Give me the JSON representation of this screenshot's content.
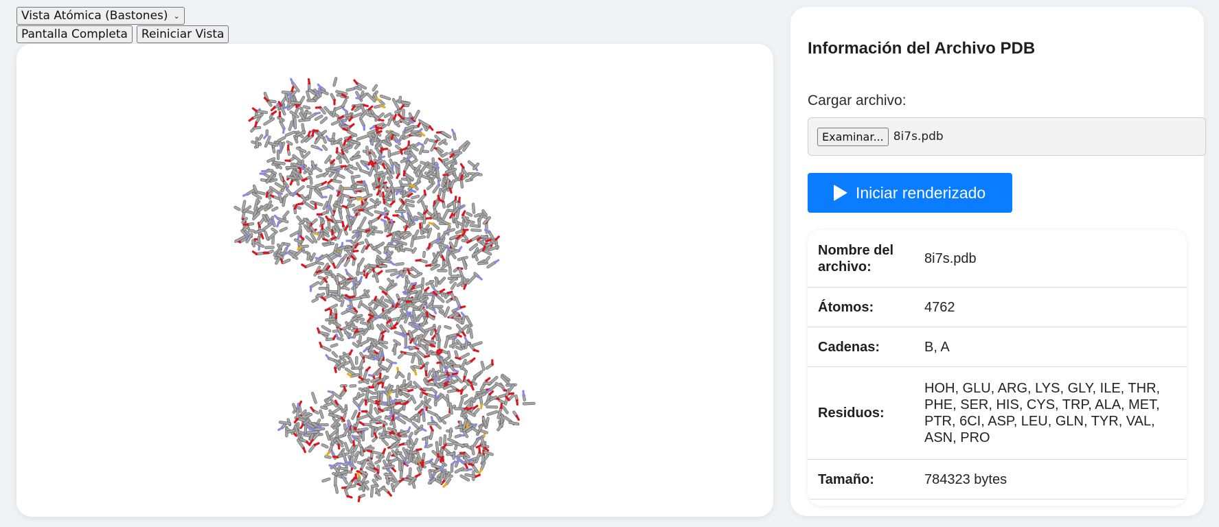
{
  "controls": {
    "view_select": "Vista Atómica (Bastones)",
    "fullscreen_label": "Pantalla Completa",
    "reset_label": "Reiniciar Vista"
  },
  "panel": {
    "title": "Información del Archivo PDB",
    "upload_label": "Cargar archivo:",
    "browse_label": "Examinar...",
    "file_name": "8i7s.pdb",
    "render_label": "Iniciar renderizado",
    "accent_color": "#0a7cff",
    "info": [
      {
        "key": "Nombre del archivo:",
        "value": "8i7s.pdb"
      },
      {
        "key": "Átomos:",
        "value": "4762"
      },
      {
        "key": "Cadenas:",
        "value": "B, A"
      },
      {
        "key": "Residuos:",
        "value": "HOH, GLU, ARG, LYS, GLY, ILE, THR, PHE, SER, HIS, CYS, TRP, ALA, MET, PTR, 6CI, ASP, LEU, GLN, TYR, VAL, ASN, PRO"
      },
      {
        "key": "Tamaño:",
        "value": "784323 bytes"
      }
    ]
  },
  "viewer": {
    "style": "sticks",
    "atom_colors": {
      "carbon": "#a8a8a8",
      "oxygen": "#e0141c",
      "nitrogen": "#8a8ae6",
      "sulfur": "#e0b020"
    }
  }
}
